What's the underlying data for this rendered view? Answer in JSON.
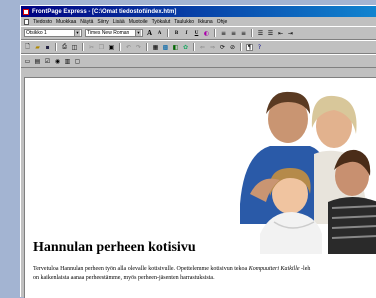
{
  "window": {
    "title": "FrontPage Express - [C:\\Omat tiedostot\\index.htm]"
  },
  "menu": [
    "Tiedosto",
    "Muokkaa",
    "Näytä",
    "Siirry",
    "Lisää",
    "Muotoile",
    "Työkalut",
    "Taulukko",
    "Ikkuna",
    "Ohje"
  ],
  "toolbar": {
    "style_value": "Otsikko 1",
    "font_value": "Times New Roman",
    "bold": "B",
    "italic": "I",
    "underline": "U",
    "grow_font": "A",
    "shrink_font": "A"
  },
  "content": {
    "heading": "Hannulan perheen kotisivu",
    "paragraph_line1_a": "Tervetuloa Hannulan perheen työn alla olevalle kotisivulle. Opettelemme kotisivun tekoa",
    "paragraph_line1_italic": "Kompuutteri Kaikille",
    "paragraph_line1_b": "-leh",
    "paragraph_line2": "on kaikenlaista aanaa perheestämme, myös perheen-jäsenten harrastuksista."
  },
  "colors": {
    "desktop": "#a3b4d2",
    "titlebar_start": "#000080",
    "titlebar_end": "#1084d0",
    "chrome": "#c0c0c0"
  }
}
